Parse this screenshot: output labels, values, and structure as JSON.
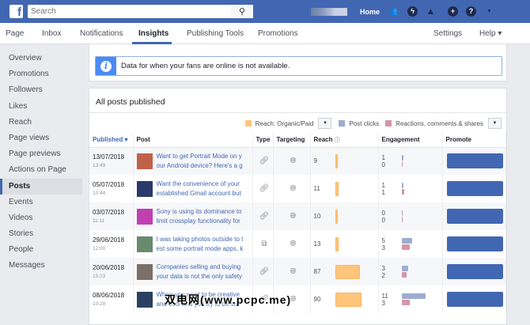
{
  "topbar": {
    "search_placeholder": "Search",
    "home": "Home"
  },
  "nav": {
    "tabs": [
      "Page",
      "Inbox",
      "Notifications",
      "Insights",
      "Publishing Tools",
      "Promotions"
    ],
    "settings": "Settings",
    "help": "Help ▾"
  },
  "sidebar": {
    "items": [
      "Overview",
      "Promotions",
      "Followers",
      "Likes",
      "Reach",
      "Page views",
      "Page previews",
      "Actions on Page",
      "Posts",
      "Events",
      "Videos",
      "Stories",
      "People",
      "Messages"
    ],
    "active": "Posts"
  },
  "info": {
    "text": "Data for when your fans are online is not available."
  },
  "posts": {
    "title": "All posts published",
    "legend": {
      "reach": "Reach: Organic/Paid",
      "clicks": "Post clicks",
      "reactions": "Reactions, comments & shares"
    },
    "columns": {
      "published": "Published ▾",
      "post": "Post",
      "type": "Type",
      "targeting": "Targeting",
      "reach": "Reach",
      "engagement": "Engagement",
      "promote": "Promote"
    },
    "rows": [
      {
        "date": "13/07/2018",
        "time": "13:49",
        "text": "Want to get Portrait Mode on your Android device? Here's a guide",
        "type": "link",
        "reach": 9,
        "clicks": 1,
        "reactions": 0,
        "thumb": "#c0614a"
      },
      {
        "date": "05/07/2018",
        "time": "10:44",
        "text": "Want the convenience of your established Gmail account but also",
        "type": "link",
        "reach": 11,
        "clicks": 1,
        "reactions": 1,
        "thumb": "#2a3a6a"
      },
      {
        "date": "03/07/2018",
        "time": "11:11",
        "text": "Sony is using its dominance to limit crossplay functionality for a",
        "type": "link",
        "reach": 10,
        "clicks": 0,
        "reactions": 0,
        "thumb": "#c040b0"
      },
      {
        "date": "29/06/2018",
        "time": "12:00",
        "text": "I was taking photos outside to test some portrait mode apps, kno",
        "type": "album",
        "reach": 13,
        "clicks": 5,
        "reactions": 3,
        "thumb": "#6a8a70"
      },
      {
        "date": "20/06/2018",
        "time": "15:23",
        "text": "Companies selling and buying your data is not the only safety con",
        "type": "link",
        "reach": 87,
        "clicks": 3,
        "reactions": 2,
        "thumb": "#7a7068"
      },
      {
        "date": "08/06/2018",
        "time": "10:28",
        "text": "When you want to be creative and cool and you try to be su",
        "type": "link",
        "reach": 90,
        "clicks": 11,
        "reactions": 3,
        "thumb": "#2a4060"
      }
    ]
  },
  "watermark": "双电网(www.pcpc.me)",
  "colors": {
    "brand": "#4267b2",
    "reach": "#ffc57b",
    "clicks": "#9cadd0",
    "reactions": "#d595a8"
  }
}
